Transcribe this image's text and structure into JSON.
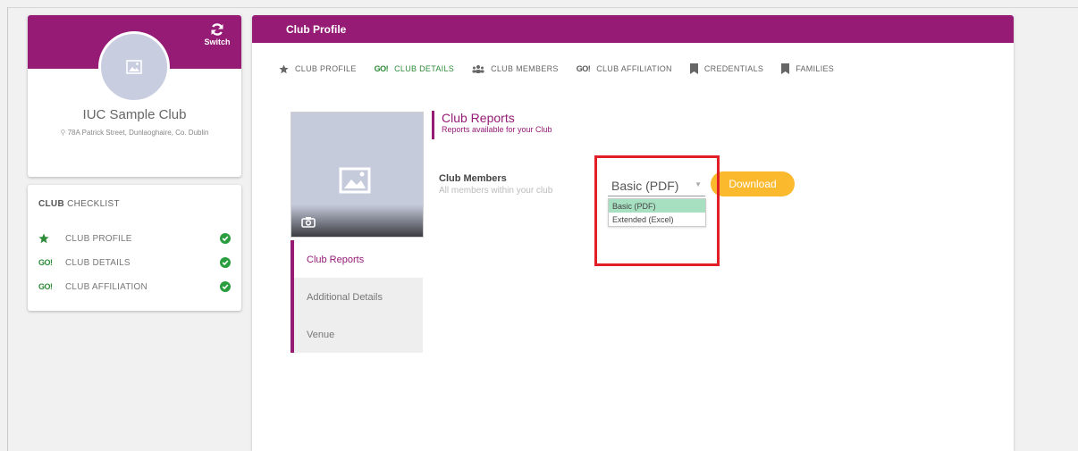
{
  "club": {
    "name": "IUC Sample Club",
    "address": "78A Patrick Street, Dunlaoghaire, Co. Dublin",
    "switch_label": "Switch"
  },
  "checklist": {
    "title_bold": "CLUB",
    "title_rest": " CHECKLIST",
    "items": [
      {
        "label": "CLUB PROFILE",
        "icon": "star-icon"
      },
      {
        "label": "CLUB DETAILS",
        "icon": "go-icon"
      },
      {
        "label": "CLUB AFFILIATION",
        "icon": "go-icon"
      }
    ],
    "go_text": "GO!"
  },
  "main": {
    "title": "Club Profile",
    "tabs": [
      {
        "label": "CLUB PROFILE",
        "icon": "star-icon"
      },
      {
        "label": "CLUB DETAILS",
        "icon": "go-icon",
        "active": true
      },
      {
        "label": "CLUB MEMBERS",
        "icon": "people-icon"
      },
      {
        "label": "CLUB AFFILIATION",
        "icon": "go-icon"
      },
      {
        "label": "CREDENTIALS",
        "icon": "bookmark-icon"
      },
      {
        "label": "FAMILIES",
        "icon": "bookmark-icon"
      }
    ]
  },
  "sidenav": {
    "items": [
      {
        "label": "Club Reports",
        "active": true
      },
      {
        "label": "Additional Details"
      },
      {
        "label": "Venue"
      }
    ]
  },
  "reports": {
    "title": "Club Reports",
    "subtitle": "Reports available for your Club",
    "row_label": "Club Members",
    "row_desc": "All members within your club",
    "select_value": "Basic (PDF)",
    "options": [
      "Basic (PDF)",
      "Extended (Excel)"
    ],
    "download_label": "Download"
  },
  "colors": {
    "brand": "#951b75",
    "go_green": "#2e8b3a",
    "download": "#fbb92e",
    "highlight": "#e21e26",
    "option_selected": "#a7dfc1"
  }
}
